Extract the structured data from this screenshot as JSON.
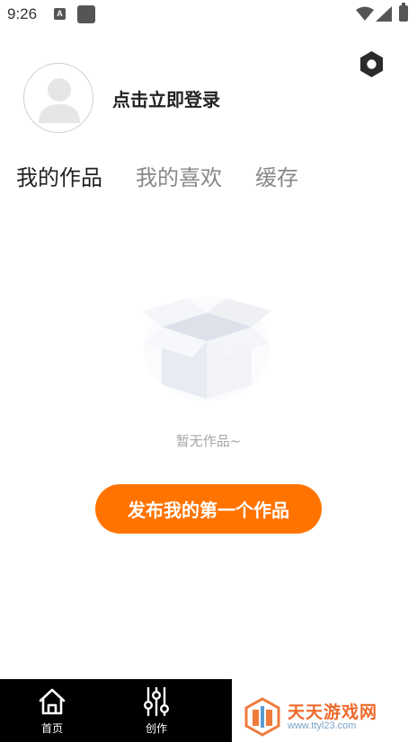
{
  "status_bar": {
    "time": "9:26",
    "notification_badge": "A",
    "battery_level": 1.0
  },
  "profile": {
    "login_prompt": "点击立即登录"
  },
  "tabs": [
    {
      "label": "我的作品",
      "active": true
    },
    {
      "label": "我的喜欢",
      "active": false
    },
    {
      "label": "缓存",
      "active": false
    }
  ],
  "empty_state": {
    "message": "暂无作品~"
  },
  "publish_button": {
    "label": "发布我的第一个作品"
  },
  "bottom_nav": {
    "items": [
      {
        "label": "首页",
        "icon": "home-icon"
      },
      {
        "label": "创作",
        "icon": "sliders-icon"
      }
    ]
  },
  "watermark": {
    "title": "天天游戏网",
    "url": "www.ttyl23.com"
  },
  "colors": {
    "accent": "#ff7400",
    "tab_active": "#222222",
    "tab_inactive": "#888888",
    "nav_background": "#000000",
    "watermark_title": "#ee6a2c"
  }
}
